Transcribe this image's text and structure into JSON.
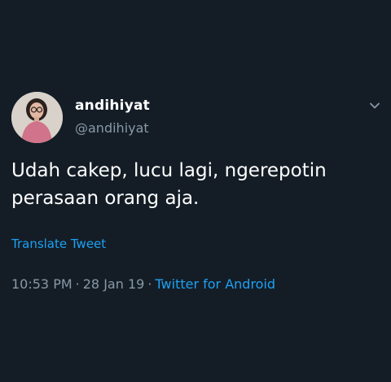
{
  "colors": {
    "background": "#141d26",
    "text_primary": "#ffffff",
    "text_secondary": "#8899a6",
    "accent": "#1da1f2"
  },
  "tweet": {
    "avatar_icon": "user-avatar",
    "display_name": "andihiyat",
    "handle": "@andihiyat",
    "menu_icon": "chevron-down-icon",
    "text": "Udah cakep, lucu lagi, ngerepotin perasaan orang aja.",
    "translate_label": "Translate Tweet",
    "time": "10:53 PM",
    "separator": "·",
    "date": "28 Jan 19",
    "source": "Twitter for Android"
  }
}
